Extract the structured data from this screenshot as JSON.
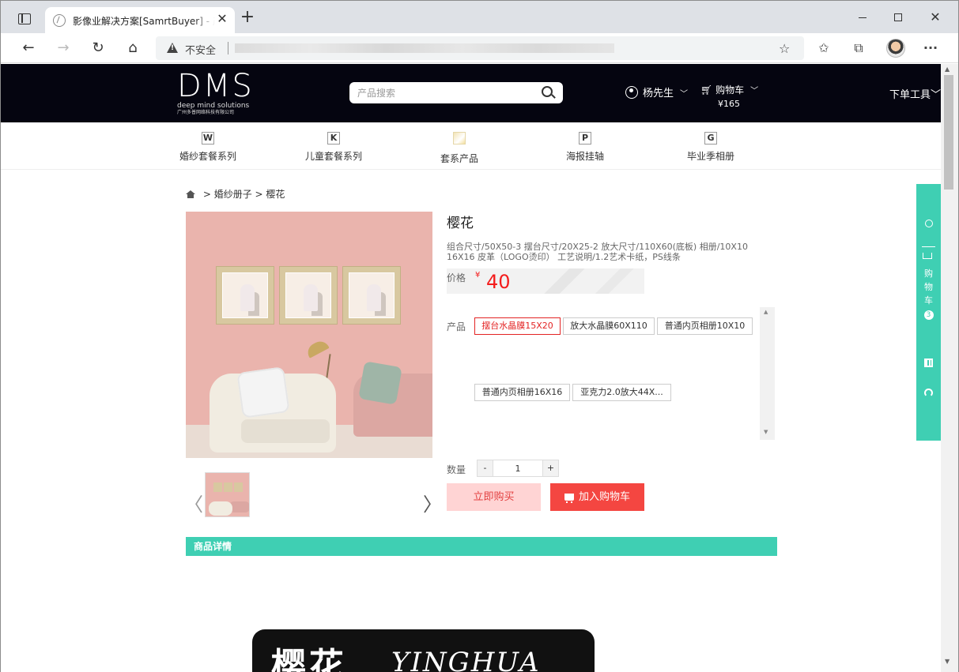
{
  "browser": {
    "tab_title": "影像业解决方案[SamrtBuyer] - 产品详情",
    "tab_close": "✕",
    "new_tab": "+",
    "security_label": "不安全",
    "minimize": "",
    "maximize": "",
    "close": "✕",
    "back": "←",
    "forward": "→",
    "reload": "↻",
    "home": "⌂",
    "more": "···"
  },
  "header": {
    "logo_text": "DMS",
    "logo_sub": "deep mind solutions",
    "logo_sub2": "广州多普网络科技有限公司",
    "search_placeholder": "产品搜索",
    "user_name": "杨先生",
    "cart_label": "购物车",
    "cart_total": "¥165",
    "order_tool": "下单工具"
  },
  "categories": [
    {
      "badge": "W",
      "label": "婚纱套餐系列"
    },
    {
      "badge": "K",
      "label": "儿童套餐系列"
    },
    {
      "badge": "",
      "label": "套系产品"
    },
    {
      "badge": "P",
      "label": "海报挂轴"
    },
    {
      "badge": "G",
      "label": "毕业季相册"
    }
  ],
  "breadcrumb": {
    "level1": "> 婚纱册子",
    "level2": "> 樱花"
  },
  "product": {
    "title": "樱花",
    "description": "组合尺寸/50X50-3 摆台尺寸/20X25-2 放大尺寸/110X60(底板) 相册/10X10 16X16 皮革（LOGO烫印） 工艺说明/1.2艺术卡纸，PS线条",
    "price_label": "价格",
    "currency": "¥",
    "price": "40",
    "options_label": "产品",
    "options": [
      {
        "label": "摆台水晶膜15X20",
        "selected": true
      },
      {
        "label": "放大水晶膜60X110",
        "selected": false
      },
      {
        "label": "普通内页相册10X10",
        "selected": false
      },
      {
        "label": "普通内页相册16X16",
        "selected": false
      },
      {
        "label": "亚克力2.0放大44X...",
        "selected": false
      }
    ],
    "quantity_label": "数量",
    "quantity": "1",
    "minus": "-",
    "plus": "+",
    "buy_now": "立即购买",
    "add_to_cart": "加入购物车",
    "thumb_prev": "〈",
    "thumb_next": "〉"
  },
  "details": {
    "bar_title": "商品详情",
    "banner_cn": "樱花",
    "banner_en": "YINGHUA"
  },
  "side_panel": {
    "cart_text": "购物车",
    "cart_count": "3"
  },
  "colors": {
    "accent": "#3fcfb3",
    "price_red": "#f41c1c",
    "header_bg": "#050510"
  }
}
